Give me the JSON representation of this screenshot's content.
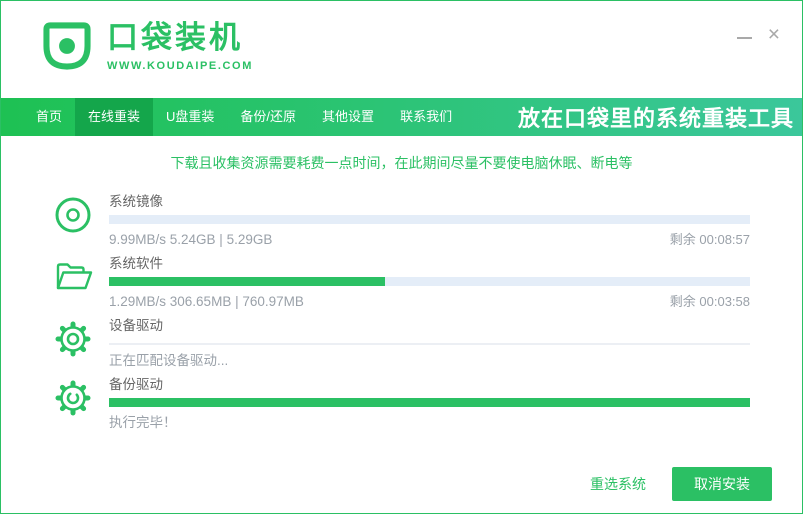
{
  "window": {
    "minimize_icon": "minimize-dash",
    "close_icon": "×"
  },
  "header": {
    "app_title": "口袋装机",
    "app_url": "WWW.KOUDAIPE.COM"
  },
  "nav": {
    "tabs": [
      {
        "label": "首页",
        "active": false
      },
      {
        "label": "在线重装",
        "active": true
      },
      {
        "label": "U盘重装",
        "active": false
      },
      {
        "label": "备份/还原",
        "active": false
      },
      {
        "label": "其他设置",
        "active": false
      },
      {
        "label": "联系我们",
        "active": false
      }
    ],
    "tagline": "放在口袋里的系统重装工具"
  },
  "notice": "下载且收集资源需要耗费一点时间，在此期间尽量不要使电脑休眠、断电等",
  "tasks": [
    {
      "label": "系统镜像",
      "icon": "disc-icon",
      "detail": "9.99MB/s 5.24GB | 5.29GB",
      "remaining": "剩余 00:08:57",
      "progress_percent": 0,
      "bar_style": "normal"
    },
    {
      "label": "系统软件",
      "icon": "folder-icon",
      "detail": "1.29MB/s 306.65MB | 760.97MB",
      "remaining": "剩余 00:03:58",
      "progress_percent": 43,
      "bar_style": "normal"
    },
    {
      "label": "设备驱动",
      "icon": "gear-icon",
      "detail": "正在匹配设备驱动...",
      "remaining": "",
      "progress_percent": 0,
      "bar_style": "thin"
    },
    {
      "label": "备份驱动",
      "icon": "gear-sync-icon",
      "detail": "执行完毕！",
      "remaining": "",
      "progress_percent": 100,
      "bar_style": "normal"
    }
  ],
  "footer": {
    "reselect_label": "重选系统",
    "cancel_label": "取消安装"
  },
  "colors": {
    "accent_green": "#2BC064",
    "nav_gradient_start": "#1EC153",
    "nav_gradient_end": "#3BC79B",
    "active_tab_green": "#14A64B",
    "progress_track": "#E4EDF8"
  }
}
